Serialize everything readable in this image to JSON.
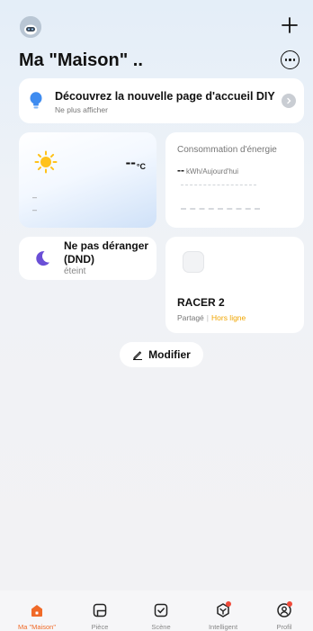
{
  "home": {
    "title": "Ma \"Maison\" .."
  },
  "banner": {
    "title": "Découvrez la nouvelle page d'accueil DIY",
    "subtitle": "Ne plus afficher"
  },
  "weather": {
    "temperature": "--",
    "unit": "°C",
    "line1": "–",
    "line2": "–"
  },
  "energy": {
    "title": "Consommation d'énergie",
    "value": "--",
    "unit": "kWh/Aujourd'hui"
  },
  "dnd": {
    "title": "Ne pas déranger (DND)",
    "status": "éteint"
  },
  "device": {
    "name": "RACER 2",
    "shared": "Partagé",
    "separator": "|",
    "status": "Hors ligne",
    "status_color": "#f0a500"
  },
  "modify_label": "Modifier",
  "tabs": [
    {
      "label": "Ma \"Maison\"",
      "icon": "home-icon",
      "active": true
    },
    {
      "label": "Pièce",
      "icon": "room-icon",
      "active": false
    },
    {
      "label": "Scène",
      "icon": "scene-icon",
      "active": false
    },
    {
      "label": "Intelligent",
      "icon": "smart-icon",
      "active": false,
      "badge": true
    },
    {
      "label": "Profil",
      "icon": "profile-icon",
      "active": false,
      "badge": true
    }
  ],
  "colors": {
    "accent": "#f06a28",
    "badge": "#f04a3a",
    "bulb": "#3f8cf0",
    "moon": "#6a4fd6",
    "sun": "#ffc21a"
  }
}
